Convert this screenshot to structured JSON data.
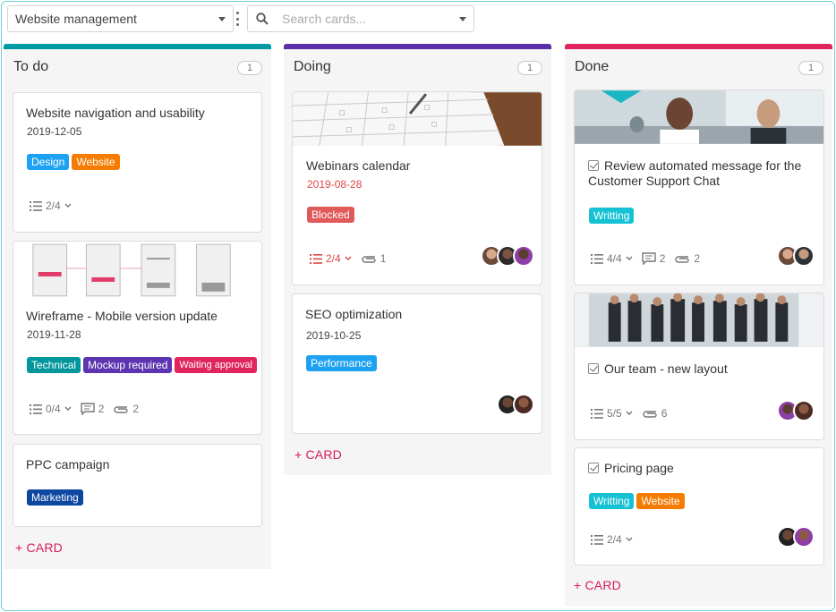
{
  "toolbar": {
    "board_select_value": "Website management",
    "search_placeholder": "Search cards..."
  },
  "colors": {
    "todo": "#009ba2",
    "doing": "#5a2ea6",
    "done": "#e0245e",
    "accent": "#d81b60"
  },
  "columns": [
    {
      "title": "To do",
      "count": "1",
      "add_label": "+ CARD",
      "cards": [
        {
          "title": "Website navigation and usability",
          "date": "2019-12-05",
          "tags": [
            "Design",
            "Website"
          ],
          "checklist": "2/4"
        },
        {
          "title": "Wireframe - Mobile version update",
          "date": "2019-11-28",
          "tags": [
            "Technical",
            "Mockup required",
            "Waiting approval"
          ],
          "checklist": "0/4",
          "comments": "2",
          "attachments": "2"
        },
        {
          "title": "PPC campaign",
          "tags": [
            "Marketing"
          ]
        }
      ]
    },
    {
      "title": "Doing",
      "count": "1",
      "add_label": "+ CARD",
      "cards": [
        {
          "title": "Webinars calendar",
          "date": "2019-08-28",
          "tags": [
            "Blocked"
          ],
          "checklist": "2/4",
          "attachments": "1"
        },
        {
          "title": "SEO optimization",
          "date": "2019-10-25",
          "tags": [
            "Performance"
          ]
        }
      ]
    },
    {
      "title": "Done",
      "count": "1",
      "add_label": "+ CARD",
      "cards": [
        {
          "title": "Review automated message for the Customer Support Chat",
          "tags": [
            "Writting"
          ],
          "checklist": "4/4",
          "comments": "2",
          "attachments": "2"
        },
        {
          "title": "Our team - new layout",
          "checklist": "5/5",
          "attachments": "6"
        },
        {
          "title": "Pricing page",
          "tags": [
            "Writting",
            "Website"
          ],
          "checklist": "2/4"
        }
      ]
    }
  ]
}
